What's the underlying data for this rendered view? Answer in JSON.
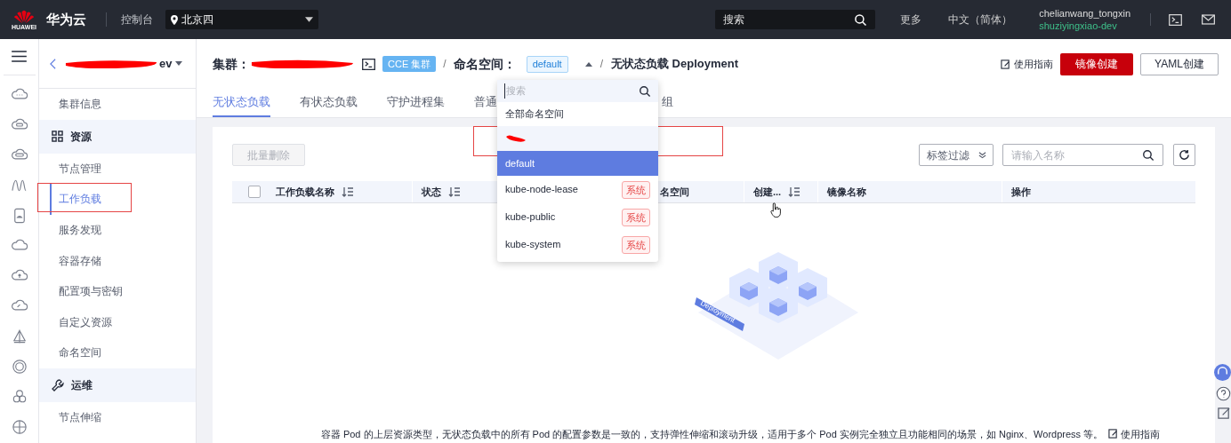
{
  "topbar": {
    "brand": "华为云",
    "logo_caption": "HUAWEI",
    "console": "控制台",
    "region": "北京四",
    "search_placeholder": "搜索",
    "more": "更多",
    "language": "中文（简体）",
    "user": "chelianwang_tongxin",
    "project": "shuziyingxiao-dev"
  },
  "sidebar": {
    "title_fragment": "ev",
    "items": [
      {
        "label": "集群信息",
        "kind": "item",
        "selected": false
      },
      {
        "label": "资源",
        "kind": "group",
        "selected": false
      },
      {
        "label": "节点管理",
        "kind": "item",
        "selected": false
      },
      {
        "label": "工作负载",
        "kind": "item",
        "selected": true
      },
      {
        "label": "服务发现",
        "kind": "item",
        "selected": false
      },
      {
        "label": "容器存储",
        "kind": "item",
        "selected": false
      },
      {
        "label": "配置项与密钥",
        "kind": "item",
        "selected": false
      },
      {
        "label": "自定义资源",
        "kind": "item",
        "selected": false
      },
      {
        "label": "命名空间",
        "kind": "item",
        "selected": false
      },
      {
        "label": "运维",
        "kind": "group",
        "selected": false
      },
      {
        "label": "节点伸缩",
        "kind": "item",
        "selected": false
      }
    ]
  },
  "header": {
    "cluster_label": "集群：",
    "separators": [
      "/",
      "/"
    ],
    "cluster_badge": "CCE 集群",
    "namespace_label": "命名空间：",
    "namespace_value": "default",
    "title": "无状态负载 Deployment",
    "guide": "使用指南",
    "primary_button": "镜像创建",
    "secondary_button": "YAML创建"
  },
  "tabs": [
    {
      "label": "无状态负载",
      "selected": true
    },
    {
      "label": "有状态负载",
      "selected": false
    },
    {
      "label": "守护进程集",
      "selected": false
    },
    {
      "label": "普通",
      "selected": false
    },
    {
      "label": "组",
      "selected": false
    }
  ],
  "toolbar": {
    "batch_delete": "批量删除",
    "label_filter": "标签过滤",
    "name_placeholder": "请输入名称"
  },
  "table": {
    "select_all_checked": false,
    "columns": [
      {
        "label": "工作负载名称",
        "sortable": true
      },
      {
        "label": "状态",
        "sortable": true
      },
      {
        "label": "名空间",
        "sortable": false
      },
      {
        "label": "创建...",
        "sortable": true
      },
      {
        "label": "镜像名称",
        "sortable": false
      },
      {
        "label": "操作",
        "sortable": false
      }
    ]
  },
  "empty": {
    "illustration_label": "Deployment",
    "description": "容器 Pod 的上层资源类型，无状态负载中的所有 Pod 的配置参数是一致的，支持弹性伸缩和滚动升级，适用于多个 Pod 实例完全独立且功能相同的场景，如 Nginx、Wordpress 等。",
    "link": "使用指南"
  },
  "namespace_dropdown": {
    "search_placeholder": "搜索",
    "options": [
      {
        "label": "全部命名空间",
        "redacted": false,
        "selected": false
      },
      {
        "redacted": true,
        "selected": false
      },
      {
        "label": "default",
        "redacted": false,
        "selected": true
      },
      {
        "label": "kube-node-lease",
        "redacted": false,
        "selected": false,
        "tag": "系统"
      },
      {
        "label": "kube-public",
        "redacted": false,
        "selected": false,
        "tag": "系统"
      },
      {
        "label": "kube-system",
        "redacted": false,
        "selected": false,
        "tag": "系统"
      }
    ]
  }
}
